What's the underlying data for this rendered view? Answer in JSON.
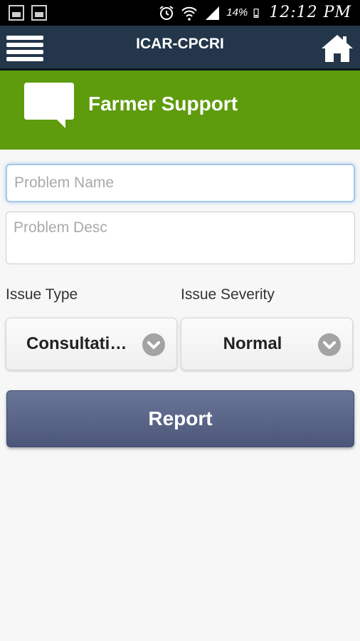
{
  "status_bar": {
    "battery_percent": "14%",
    "time": "12:12 PM",
    "icons": [
      "gallery-icon",
      "image-icon",
      "alarm-icon",
      "wifi-icon",
      "signal-icon",
      "battery-icon"
    ]
  },
  "app_bar": {
    "title": "ICAR-CPCRI",
    "menu_icon": "hamburger-menu-icon",
    "home_icon": "home-icon"
  },
  "feature": {
    "title": "Farmer Support",
    "icon": "chat-bubble-icon",
    "color": "#5e9b0d"
  },
  "form": {
    "problem_name": {
      "value": "",
      "placeholder": "Problem Name"
    },
    "problem_desc": {
      "value": "",
      "placeholder": "Problem Desc"
    },
    "issue_type": {
      "label": "Issue Type",
      "selected": "Consultati…"
    },
    "issue_severity": {
      "label": "Issue Severity",
      "selected": "Normal"
    },
    "report_label": "Report"
  },
  "colors": {
    "app_bar": "#23364a",
    "button": "#5b6688"
  }
}
